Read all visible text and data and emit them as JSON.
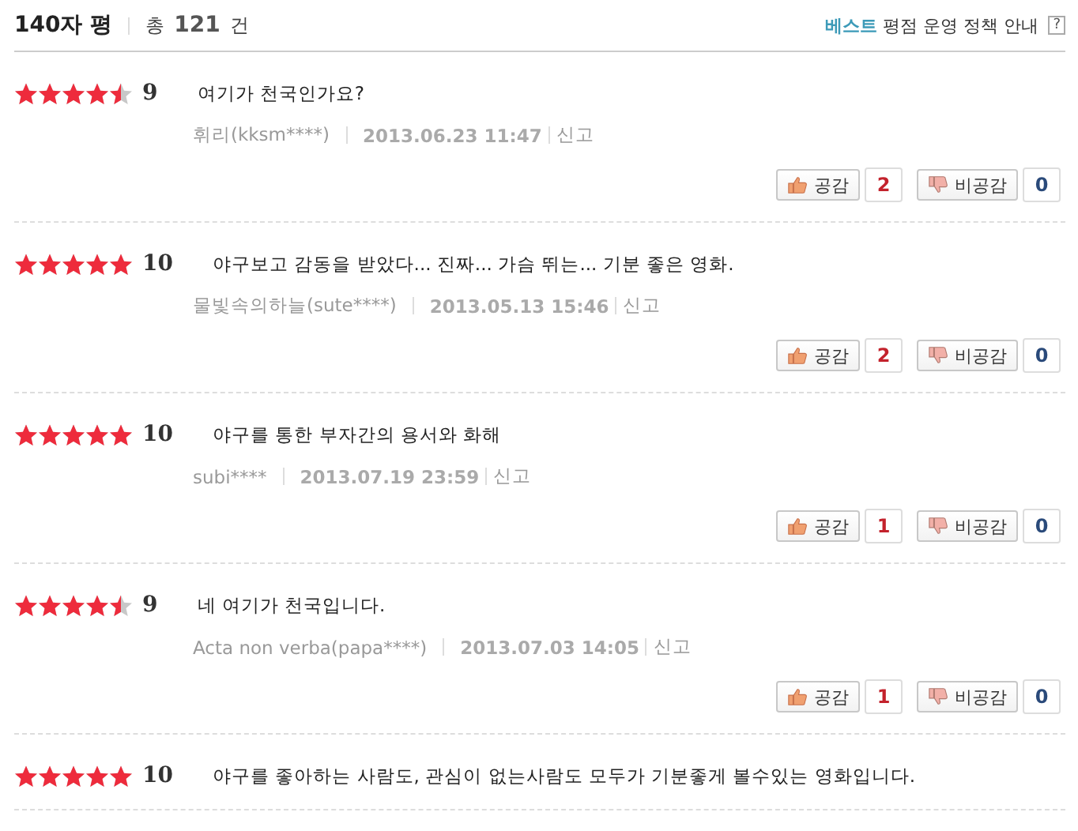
{
  "header": {
    "title": "140자 평",
    "total_prefix": "총",
    "total_count": "121",
    "total_suffix": "건",
    "policy_best": "베스트",
    "policy_text": "평점 운영 정책 안내",
    "help": "?"
  },
  "reviews": [
    {
      "stars": 4.5,
      "score": "9",
      "text": "여기가 천국인가요?",
      "author": "휘리(kksm****)",
      "date": "2013.06.23 11:47",
      "report": "신고",
      "like_label": "공감",
      "likes": "2",
      "dislike_label": "비공감",
      "dislikes": "0"
    },
    {
      "stars": 5,
      "score": "10",
      "text": "야구보고 감동을 받았다... 진짜... 가슴 뛰는... 기분 좋은 영화.",
      "author": "물빛속의하늘(sute****)",
      "date": "2013.05.13 15:46",
      "report": "신고",
      "like_label": "공감",
      "likes": "2",
      "dislike_label": "비공감",
      "dislikes": "0"
    },
    {
      "stars": 5,
      "score": "10",
      "text": "야구를 통한 부자간의 용서와 화해",
      "author": "subi****",
      "date": "2013.07.19 23:59",
      "report": "신고",
      "like_label": "공감",
      "likes": "1",
      "dislike_label": "비공감",
      "dislikes": "0"
    },
    {
      "stars": 4.5,
      "score": "9",
      "text": "네 여기가 천국입니다.",
      "author": "Acta non verba(papa****)",
      "date": "2013.07.03 14:05",
      "report": "신고",
      "like_label": "공감",
      "likes": "1",
      "dislike_label": "비공감",
      "dislikes": "0"
    },
    {
      "stars": 5,
      "score": "10",
      "text": "야구를 좋아하는 사람도, 관심이 없는사람도 모두가 기분좋게 볼수있는 영화입니다."
    }
  ]
}
